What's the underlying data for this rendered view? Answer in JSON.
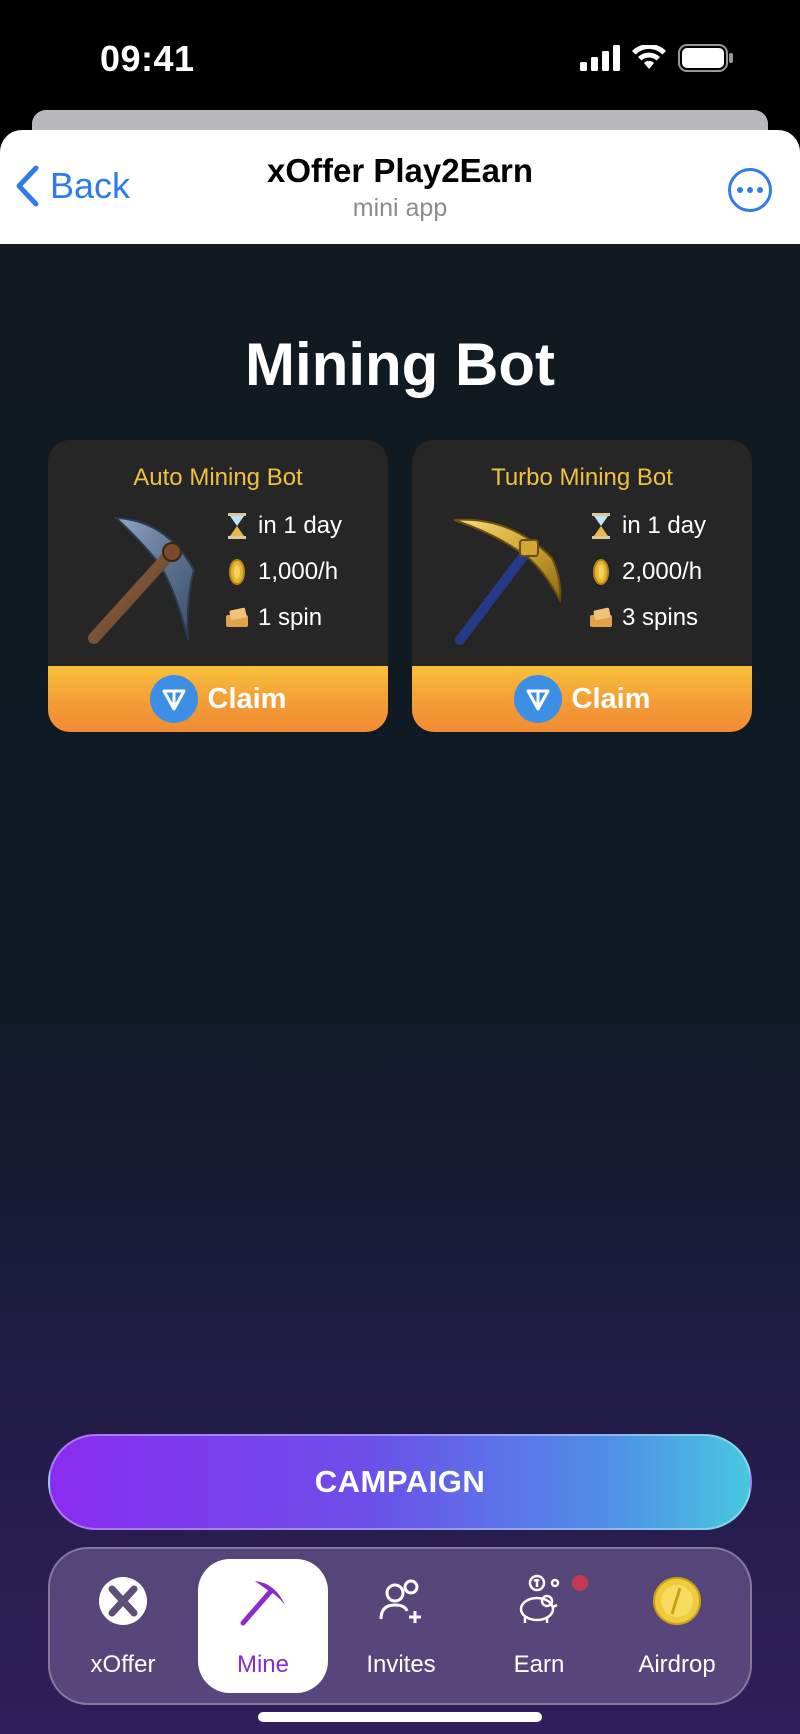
{
  "status_bar": {
    "time": "09:41"
  },
  "header": {
    "back_label": "Back",
    "title": "xOffer Play2Earn",
    "subtitle": "mini app"
  },
  "page": {
    "heading": "Mining Bot"
  },
  "cards": [
    {
      "title": "Auto Mining Bot",
      "duration": "in 1 day",
      "rate": "1,000/h",
      "spins": "1 spin",
      "claim_label": "Claim",
      "art_icon": "steel-pickaxe-icon"
    },
    {
      "title": "Turbo Mining Bot",
      "duration": "in 1 day",
      "rate": "2,000/h",
      "spins": "3 spins",
      "claim_label": "Claim",
      "art_icon": "gold-pickaxe-icon"
    }
  ],
  "campaign": {
    "label": "CAMPAIGN"
  },
  "tabs": [
    {
      "label": "xOffer",
      "icon": "xoffer-logo-icon",
      "active": false
    },
    {
      "label": "Mine",
      "icon": "pickaxe-icon",
      "active": true
    },
    {
      "label": "Invites",
      "icon": "add-user-icon",
      "active": false
    },
    {
      "label": "Earn",
      "icon": "piggy-bank-icon",
      "active": false,
      "badge": true
    },
    {
      "label": "Airdrop",
      "icon": "coin-icon",
      "active": false
    }
  ],
  "colors": {
    "accent_blue": "#2f7ce8",
    "card_title": "#f0c040",
    "claim_orange": "#f39a35",
    "active_tab": "#8a2cc8",
    "badge": "#c4394f"
  }
}
